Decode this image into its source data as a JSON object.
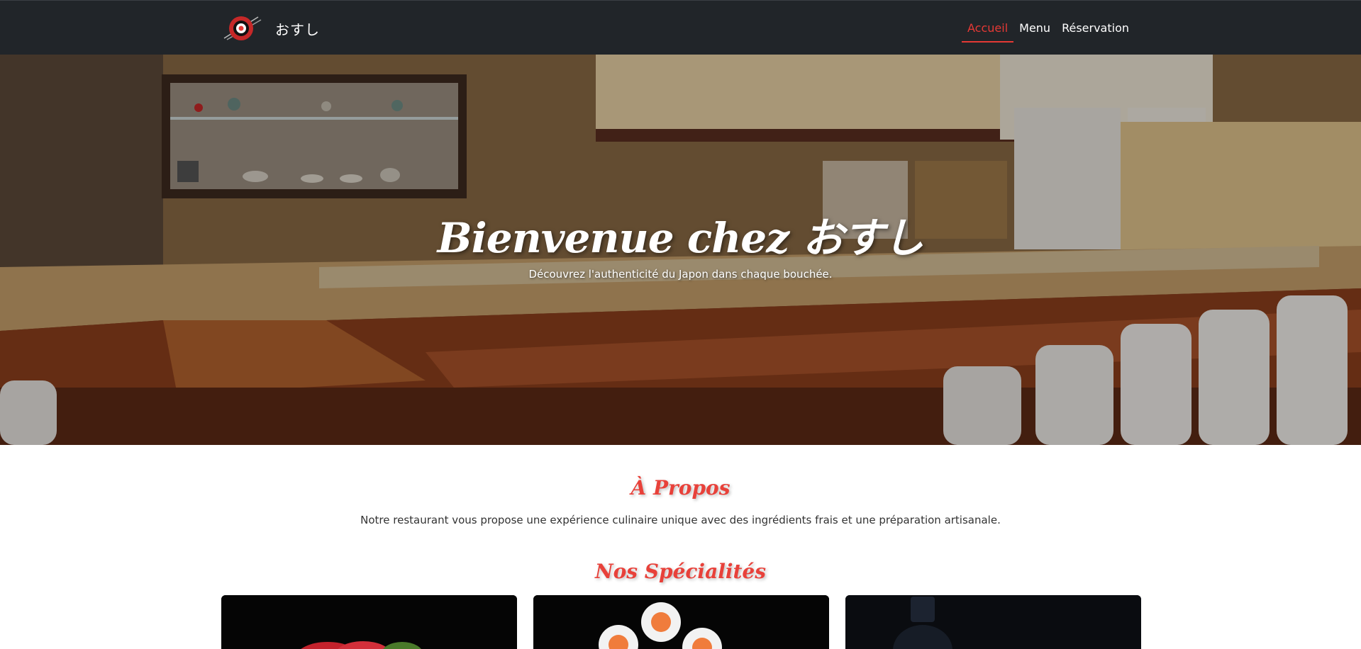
{
  "brand": {
    "name": "おすし",
    "logo_icon": "sushi-logo-icon"
  },
  "nav": {
    "items": [
      {
        "label": "Accueil",
        "active": true
      },
      {
        "label": "Menu",
        "active": false
      },
      {
        "label": "Réservation",
        "active": false
      }
    ],
    "accent_color": "#e53935"
  },
  "hero": {
    "title": "Bienvenue chez おすし",
    "subtitle": "Découvrez l'authenticité du Japon dans chaque bouchée."
  },
  "about": {
    "title": "À Propos",
    "text": "Notre restaurant vous propose une expérience culinaire unique avec des ingrédients frais et une préparation artisanale."
  },
  "specialties": {
    "title": "Nos Spécialités",
    "cards": [
      {
        "image": "sashimi-image"
      },
      {
        "image": "maki-rolls-image"
      },
      {
        "image": "sake-bottle-image"
      }
    ]
  },
  "colors": {
    "navbar": "#212529",
    "title_red": "#e8413a"
  }
}
